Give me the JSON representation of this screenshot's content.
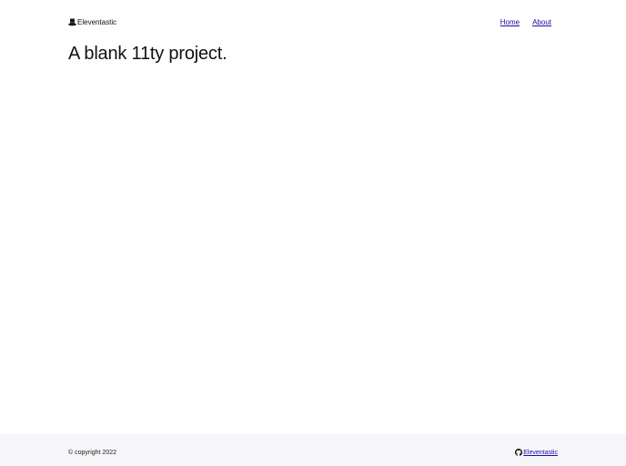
{
  "header": {
    "brand_label": "Eleventastic",
    "brand_icon": "top-hat-icon",
    "nav": [
      {
        "label": "Home"
      },
      {
        "label": "About"
      }
    ]
  },
  "main": {
    "title": "A blank 11ty project."
  },
  "footer": {
    "copyright": "© copyright 2022",
    "repo_label": "Eleventastic",
    "repo_icon": "github-icon"
  },
  "colors": {
    "link": "#1a0dab",
    "text": "#111111",
    "footer_bg": "#f6f6f8"
  }
}
